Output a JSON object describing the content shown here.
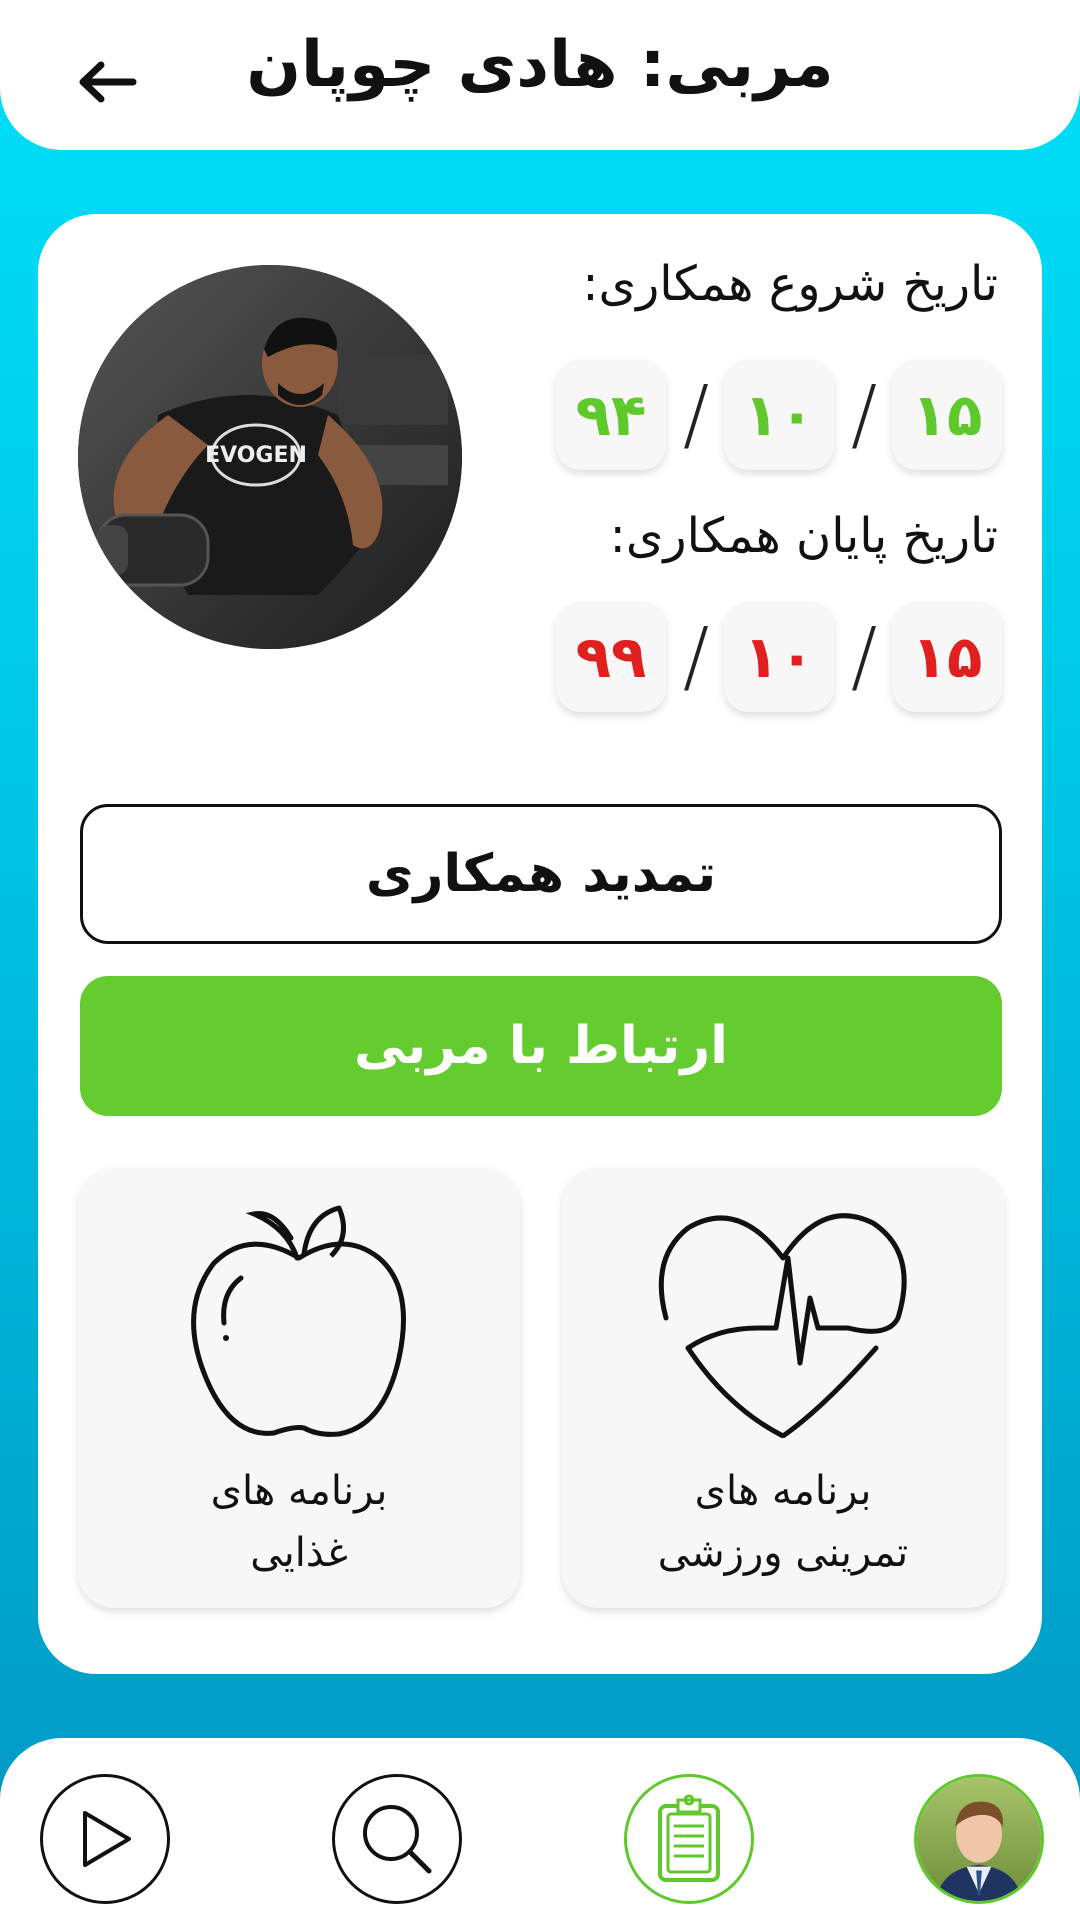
{
  "header": {
    "title": "مربی: هادی چوپان",
    "back_icon": "arrow-left-icon"
  },
  "coach": {
    "photo_icon": "coach-photo",
    "start_label": "تاریخ شروع همکاری:",
    "start_date": {
      "day": "۱۵",
      "month": "۱۰",
      "year": "۹۴",
      "color": "#5fc92b"
    },
    "end_label": "تاریخ پایان همکاری:",
    "end_date": {
      "day": "۱۵",
      "month": "۱۰",
      "year": "۹۹",
      "color": "#e01f1f"
    },
    "separator": "/"
  },
  "actions": {
    "renew_label": "تمدید همکاری",
    "contact_label": "ارتباط با مربی",
    "contact_color": "#64cc2e"
  },
  "programs": [
    {
      "line1": "برنامه های",
      "line2": "تمرینی ورزشی",
      "icon": "heart-pulse-icon"
    },
    {
      "line1": "برنامه های",
      "line2": "غذایی",
      "icon": "apple-icon"
    }
  ],
  "nav": {
    "items": [
      {
        "icon": "user-avatar",
        "active": false
      },
      {
        "icon": "clipboard-icon",
        "active": true
      },
      {
        "icon": "search-icon",
        "active": false
      },
      {
        "icon": "play-icon",
        "active": false
      }
    ],
    "accent": "#5fc92b"
  }
}
